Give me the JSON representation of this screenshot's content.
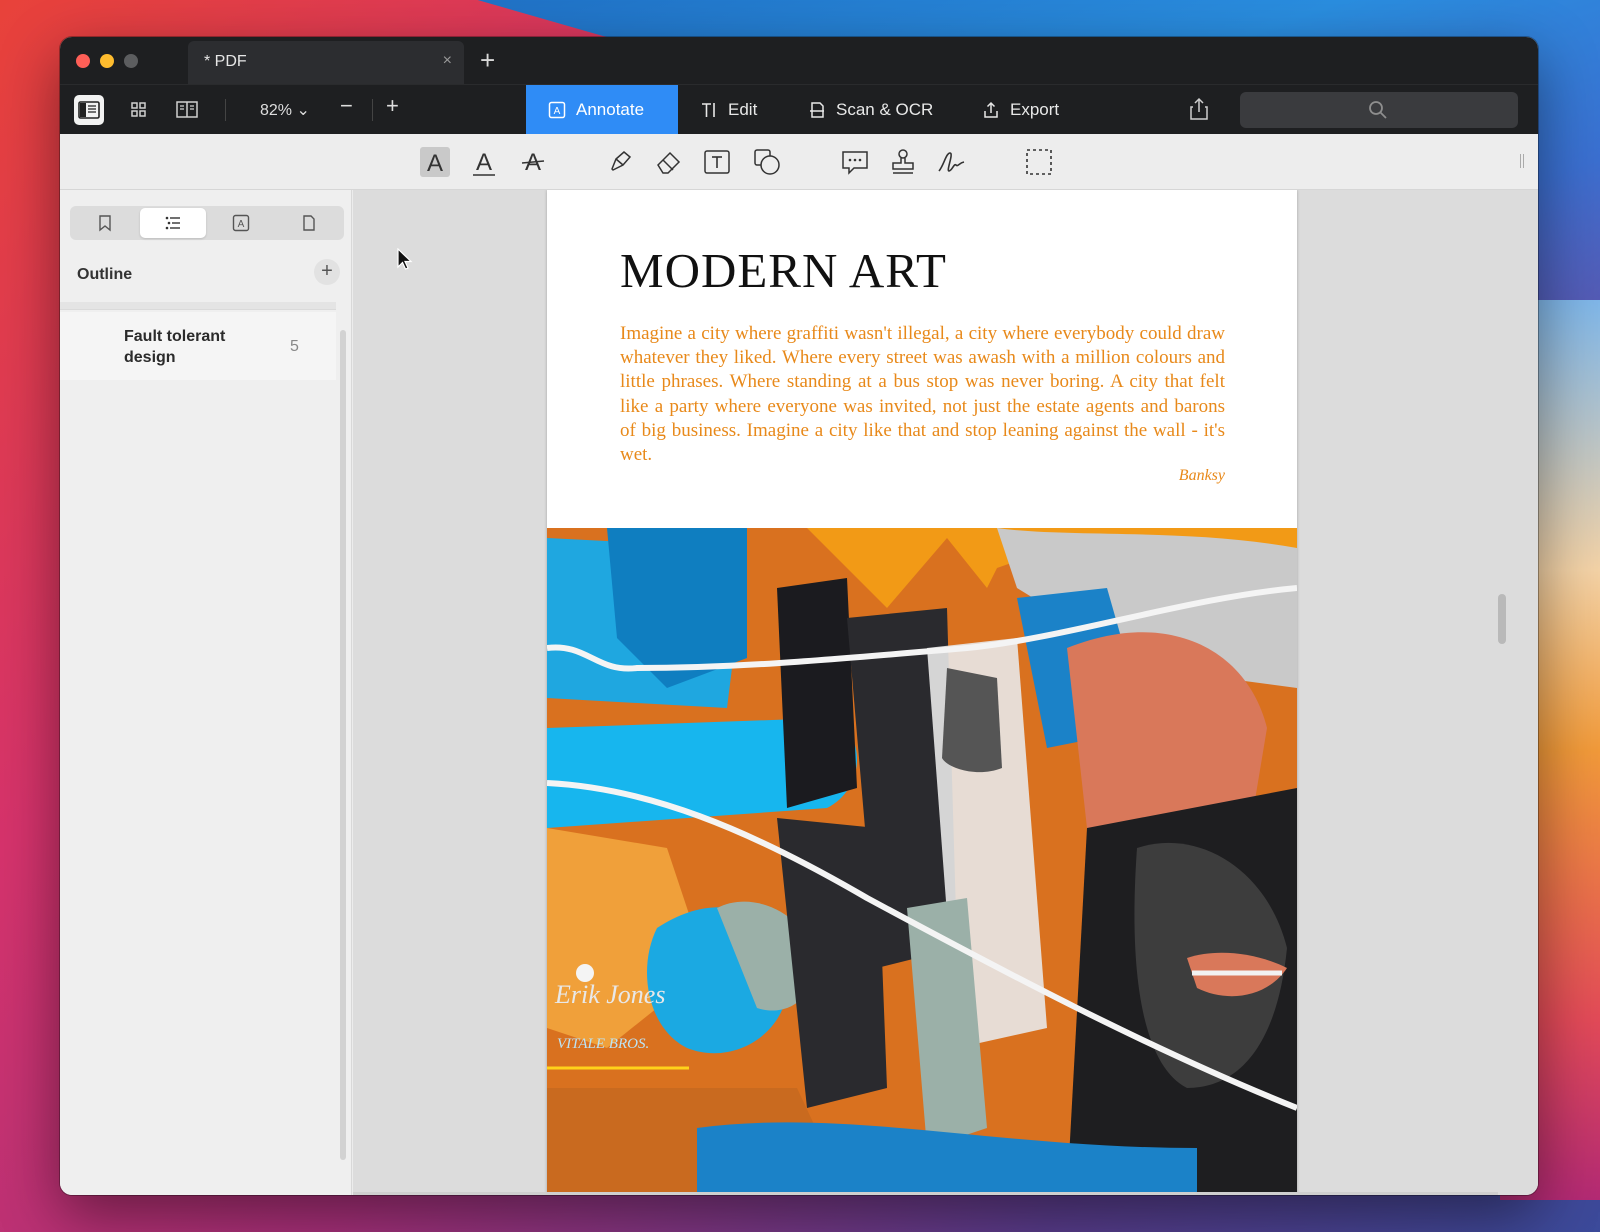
{
  "tab": {
    "title": "* PDF",
    "close": "×",
    "new": "+"
  },
  "toolbar": {
    "zoom": "82%",
    "zoom_out": "−",
    "zoom_in": "+",
    "modes": [
      {
        "label": "Annotate",
        "active": true
      },
      {
        "label": "Edit",
        "active": false
      },
      {
        "label": "Scan & OCR",
        "active": false
      },
      {
        "label": "Export",
        "active": false
      }
    ]
  },
  "annotation_tools": [
    "highlight-text-icon",
    "underline-text-icon",
    "strikethrough-text-icon",
    "highlighter-pen-icon",
    "eraser-icon",
    "text-box-icon",
    "shapes-icon",
    "comment-icon",
    "stamp-icon",
    "signature-icon",
    "area-select-icon"
  ],
  "sidebar": {
    "tabs": [
      "bookmark-icon",
      "outline-icon",
      "annotations-icon",
      "pages-icon"
    ],
    "outline_label": "Outline",
    "add": "+",
    "items": [
      {
        "title": "Fault tolerant design",
        "page": "5"
      }
    ]
  },
  "document": {
    "title": "MODERN ART",
    "body": "Imagine a city where graffiti wasn't illegal, a city where everybody could draw whatever they liked. Where every street was awash with a million colours and little phrases. Where standing at a bus stop was never boring. A city that felt like a party where everyone was invited, not just the estate agents and barons of big business. Imagine a city like that and stop leaning against the wall - it's wet.",
    "author": "Banksy"
  },
  "colors": {
    "accent": "#2f8cf6",
    "quote_text": "#e8891a",
    "chrome_dark": "#1e1f21"
  }
}
